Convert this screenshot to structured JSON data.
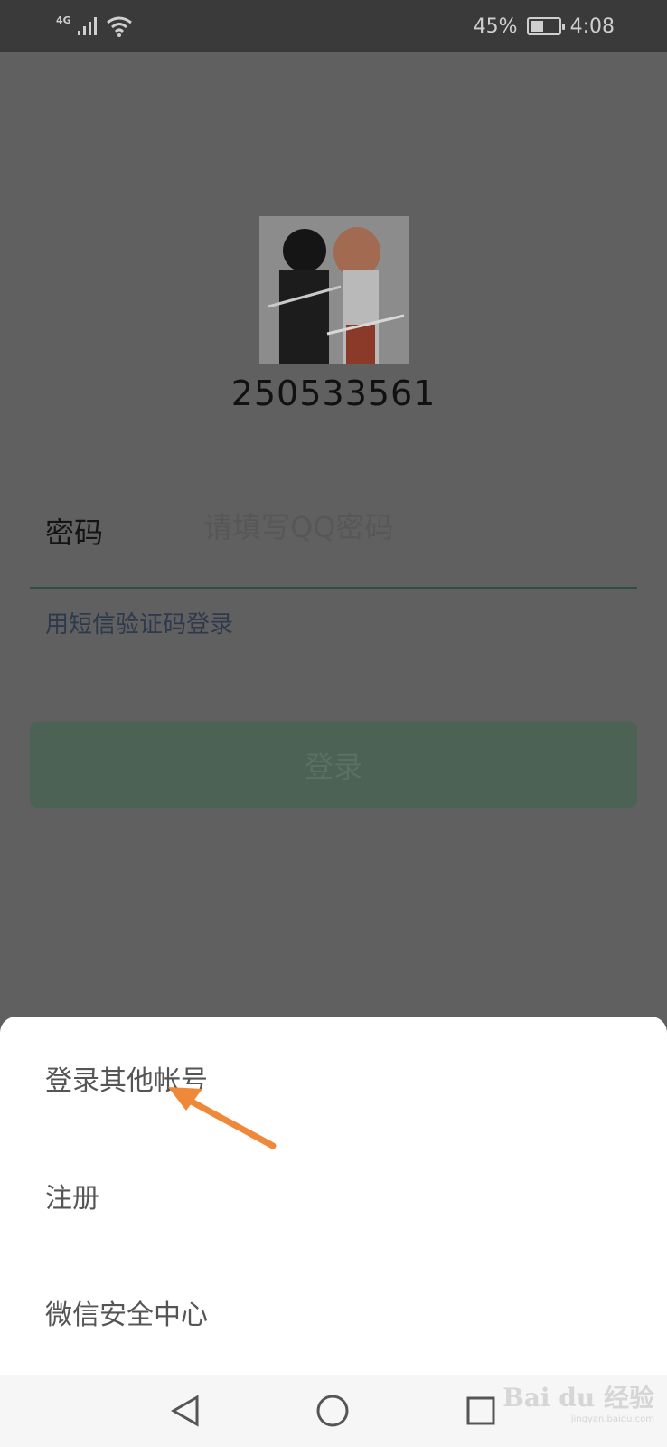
{
  "status_bar": {
    "network_type": "4G",
    "battery_percent_text": "45%",
    "battery_level": 0.45,
    "time": "4:08",
    "icons": [
      "signal-icon",
      "wifi-icon",
      "battery-icon"
    ]
  },
  "login": {
    "account": "250533561",
    "password_label": "密码",
    "password_placeholder": "请填写QQ密码",
    "sms_login_link": "用短信验证码登录",
    "login_button": "登录"
  },
  "sheet": {
    "items": [
      {
        "label": "登录其他帐号"
      },
      {
        "label": "注册"
      },
      {
        "label": "微信安全中心"
      }
    ],
    "annotation_color": "#f0883a"
  },
  "nav_bar": {
    "icons": [
      "back-icon",
      "home-icon",
      "recents-icon"
    ]
  },
  "watermark": {
    "main": "Bai du 经验",
    "sub": "jingyan.baidu.com"
  },
  "colors": {
    "overlay": "#606060",
    "login_button": "#4c6255",
    "underline": "#2c4f45",
    "sheet_bg": "#ffffff"
  }
}
